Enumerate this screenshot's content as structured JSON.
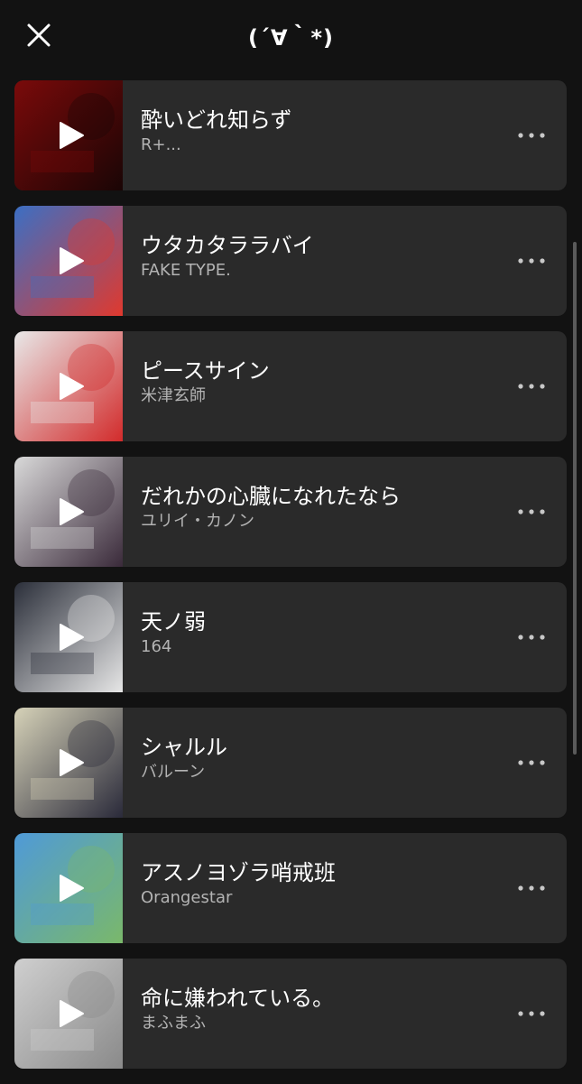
{
  "header": {
    "title": "(´∀｀*)",
    "close_icon": "close-icon"
  },
  "tracks": [
    {
      "title": "酔いどれ知らず",
      "artist": "R+...",
      "art_colors": [
        "#7a0a0a",
        "#1a0505"
      ]
    },
    {
      "title": "ウタカタララバイ",
      "artist": "FAKE TYPE.",
      "art_colors": [
        "#3b6fc4",
        "#e0392e"
      ]
    },
    {
      "title": "ピースサイン",
      "artist": "米津玄師",
      "art_colors": [
        "#e8e8e8",
        "#d22b2b"
      ]
    },
    {
      "title": "だれかの心臓になれたなら",
      "artist": "ユリイ・カノン",
      "art_colors": [
        "#d9d9d9",
        "#3a2a3a"
      ]
    },
    {
      "title": "天ノ弱",
      "artist": "164",
      "art_colors": [
        "#2b2f3a",
        "#e6e6e6"
      ]
    },
    {
      "title": "シャルル",
      "artist": "バルーン",
      "art_colors": [
        "#d6d2b8",
        "#2a2a3a"
      ]
    },
    {
      "title": "アスノヨゾラ哨戒班",
      "artist": "Orangestar",
      "art_colors": [
        "#4f9ad8",
        "#7ab86a"
      ]
    },
    {
      "title": "命に嫌われている。",
      "artist": "まふまふ",
      "art_colors": [
        "#cfcfcf",
        "#8a8a8a"
      ]
    }
  ],
  "icons": {
    "play": "play-icon",
    "more": "more-icon"
  }
}
